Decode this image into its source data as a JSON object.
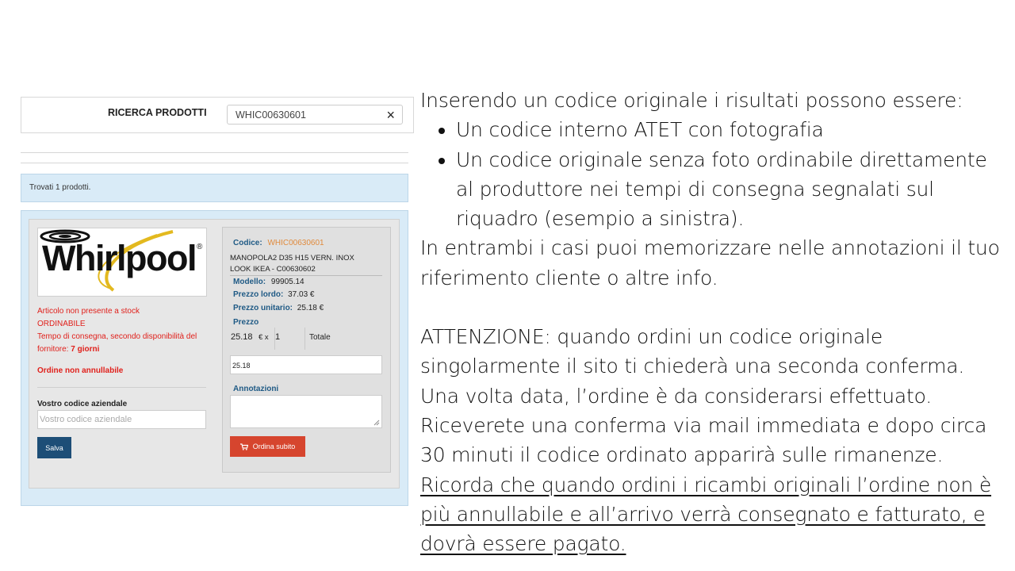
{
  "search": {
    "label": "RICERCA PRODOTTI",
    "value": "WHIC00630601",
    "clear_icon": "×"
  },
  "results": {
    "found_text": "Trovati 1 prodotti."
  },
  "product": {
    "logo_text": "Whirlpool",
    "logo_reg": "®",
    "stock_status": "Articolo non presente a stock",
    "orderable": "ORDINABILE",
    "delivery_prefix": "Tempo di consegna, secondo disponibilità del",
    "delivery_line2": "fornitore:",
    "delivery_days": "7 giorni",
    "non_cancellable": "Ordine non annullabile",
    "company_code_label": "Vostro codice aziendale",
    "company_code_placeholder": "Vostro codice aziendale",
    "save_label": "Salva",
    "code_label": "Codice:",
    "code_value": "WHIC00630601",
    "description_line1": "MANOPOLA2 D35 H15 VERN. INOX",
    "description_line2": "LOOK IKEA - C00630602",
    "model_label": "Modello:",
    "model_value": "99905.14",
    "gross_label": "Prezzo lordo:",
    "gross_value": "37.03 €",
    "unit_label": "Prezzo unitario:",
    "unit_value": "25.18 €",
    "price_label": "Prezzo",
    "price_value": "25.18",
    "currency_x": "€ x",
    "qty_value": "1",
    "total_label": "Totale",
    "total_value": "25.18",
    "notes_label": "Annotazioni",
    "order_label": "Ordina subito"
  },
  "text": {
    "intro": "Inserendo un codice originale i risultati possono essere:",
    "bullet1": "Un codice interno ATET con fotografia",
    "bullet2": "Un codice originale senza foto ordinabile direttamente al produttore nei tempi di consegna segnalati sul riquadro (esempio a sinistra).",
    "both": "In entrambi i casi puoi memorizzare nelle annotazioni il tuo riferimento cliente o altre info.",
    "attention": "ATTENZIONE: quando ordini un codice originale singolarmente il sito ti chiederà una seconda conferma. Una volta data, l’ordine è da considerarsi effettuato. Riceverete una conferma via mail immediata e dopo circa 30 minuti il codice ordinato apparirà sulle rimanenze.",
    "remember": "Ricorda che quando ordini i ricambi originali l’ordine non è più annullabile e all’arrivo verrà consegnato e fatturato, e dovrà essere pagato. "
  },
  "colors": {
    "accent_blue": "#1d4e77",
    "order_red": "#d6452e",
    "alert_red": "#e0201b",
    "code_orange": "#e08a3c",
    "panel_blue": "#d9ebf7",
    "logo_gold": "#e3b91f"
  },
  "icons": {
    "cart": "cart-icon",
    "clear": "close-icon"
  }
}
